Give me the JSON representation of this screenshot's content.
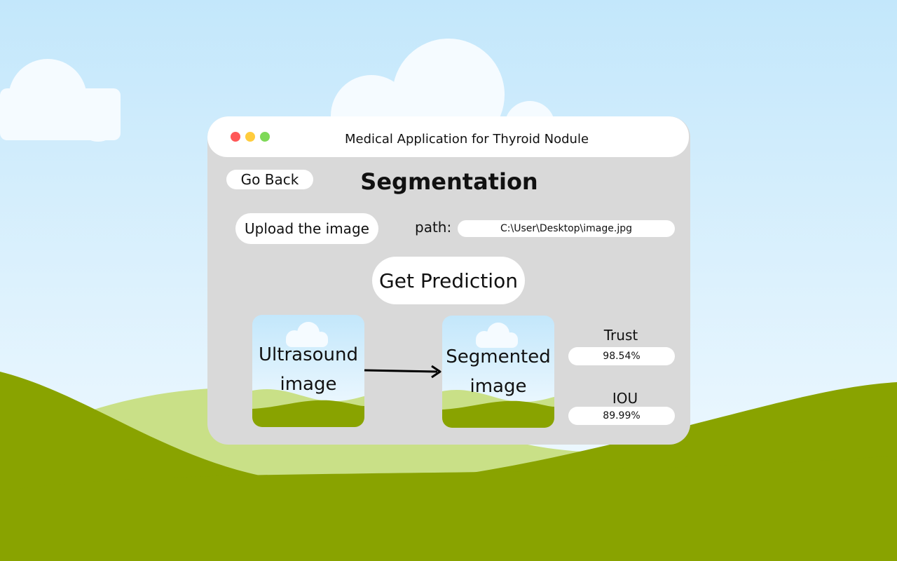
{
  "window": {
    "title": "Medical Application for Thyroid Nodule",
    "controls": [
      "close-dot",
      "minimize-dot",
      "maximize-dot"
    ]
  },
  "nav": {
    "back_label": "Go Back"
  },
  "page": {
    "title": "Segmentation"
  },
  "upload": {
    "button_label": "Upload the image",
    "path_label": "path:",
    "path_value": "C:\\User\\Desktop\\image.jpg"
  },
  "prediction": {
    "button_label": "Get Prediction"
  },
  "images": {
    "input_label_line1": "Ultrasound",
    "input_label_line2": "image",
    "output_label_line1": "Segmented",
    "output_label_line2": "image"
  },
  "metrics": {
    "trust_label": "Trust",
    "trust_value": "98.54%",
    "iou_label": "IOU",
    "iou_value": "89.99%"
  },
  "colors": {
    "sky_top": "#c5e8fb",
    "sky_bottom": "#f3fbff",
    "hill_dark": "#89a300",
    "hill_light": "#c9e087",
    "window_body": "#d9d9d9",
    "close": "#ff5757",
    "minimize": "#ffcc3d",
    "maximize": "#7ed957"
  }
}
